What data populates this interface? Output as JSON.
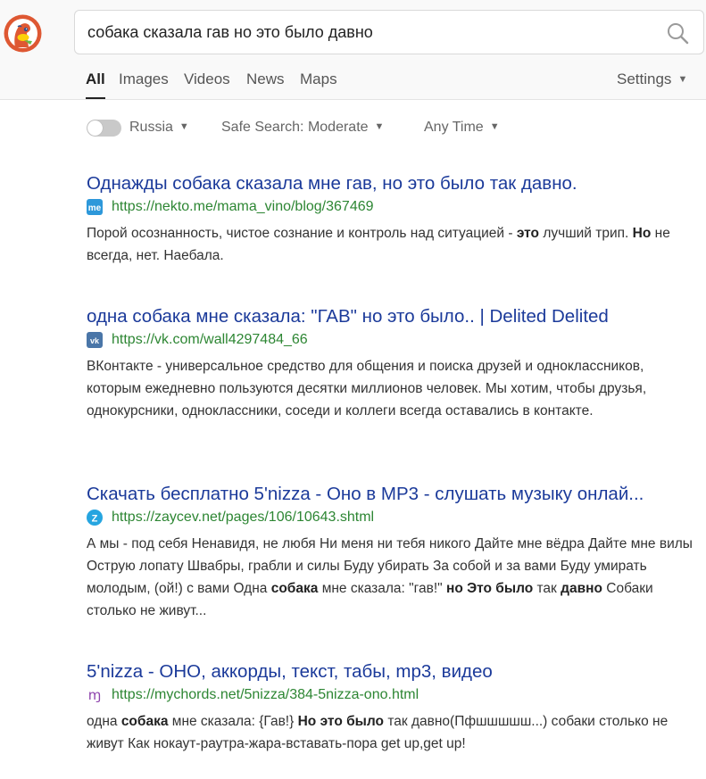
{
  "search": {
    "query": "собака сказала гав но это было давно"
  },
  "tabs": [
    {
      "label": "All",
      "active": true
    },
    {
      "label": "Images",
      "active": false
    },
    {
      "label": "Videos",
      "active": false
    },
    {
      "label": "News",
      "active": false
    },
    {
      "label": "Maps",
      "active": false
    }
  ],
  "settings_label": "Settings",
  "filters": {
    "region": "Russia",
    "region_toggle_on": false,
    "safe_search": "Safe Search: Moderate",
    "time": "Any Time"
  },
  "results": [
    {
      "title": "Однажды собака сказала мне гав, но это было так давно.",
      "url": "https://nekto.me/mama_vino/blog/367469",
      "favicon": "me-icon",
      "snippet": [
        {
          "t": "Порой осознанность, чистое сознание и контроль над ситуацией - "
        },
        {
          "t": "это",
          "b": true
        },
        {
          "t": " лучший трип. "
        },
        {
          "t": "Но",
          "b": true
        },
        {
          "t": " не всегда, нет. Наебала."
        }
      ]
    },
    {
      "title": "одна собака мне сказала: \"ГАВ\" но это было.. | Delited Delited",
      "url": "https://vk.com/wall4297484_66",
      "favicon": "vk-icon",
      "snippet": [
        {
          "t": "ВКонтакте - универсальное средство для общения и поиска друзей и одноклассников, которым ежедневно пользуются десятки миллионов человек. Мы хотим, чтобы друзья, однокурсники, одноклассники, соседи и коллеги всегда оставались в контакте."
        }
      ]
    },
    {
      "title": "Скачать бесплатно 5'nizza - Оно в MP3 - слушать музыку онлай...",
      "url": "https://zaycev.net/pages/106/10643.shtml",
      "favicon": "zaycev-icon",
      "snippet": [
        {
          "t": "А мы - под себя Ненавидя, не любя Ни меня ни тебя никого Дайте мне вёдра Дайте мне вилы Острую лопату Швабры, грабли и силы Буду убирать За собой и за вами Буду умирать молодым, (ой!) с вами Одна "
        },
        {
          "t": "собака",
          "b": true
        },
        {
          "t": " мне сказала: \"гав!\" "
        },
        {
          "t": "но Это было",
          "b": true
        },
        {
          "t": " так "
        },
        {
          "t": "давно",
          "b": true
        },
        {
          "t": " Собаки столько не живут..."
        }
      ]
    },
    {
      "title": "5'nizza - ОНО, аккорды, текст, табы, mp3, видео",
      "url": "https://mychords.net/5nizza/384-5nizza-ono.html",
      "favicon": "mychords-icon",
      "snippet": [
        {
          "t": "одна "
        },
        {
          "t": "собака",
          "b": true
        },
        {
          "t": " мне сказала: {Гав!} "
        },
        {
          "t": "Но это было",
          "b": true
        },
        {
          "t": " так давно(Пфшшшшш...) собаки столько не живут Как нокаут-раутра-жара-вставать-пора get up,get up!"
        }
      ]
    }
  ]
}
